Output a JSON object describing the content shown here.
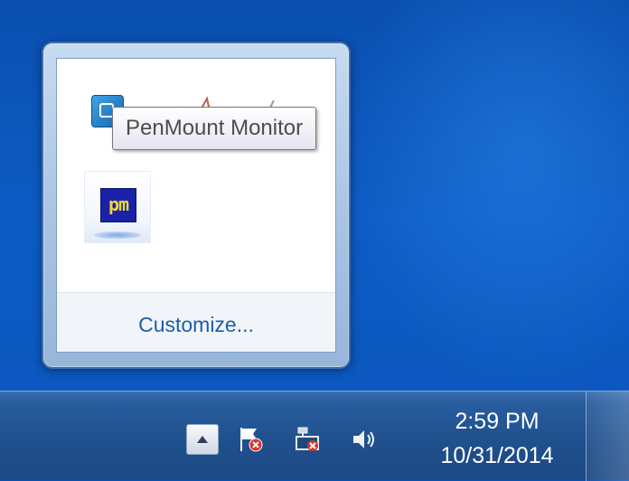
{
  "tooltip": {
    "text": "PenMount Monitor"
  },
  "flyout": {
    "icons": [
      {
        "name": "PenMount Monitor",
        "icon": "penmount-monitor-icon"
      },
      {
        "name": "pm",
        "icon": "pm-icon",
        "label": "pm"
      }
    ],
    "customize_label": "Customize..."
  },
  "taskbar": {
    "tray_icons": [
      "show-hidden-icons-icon",
      "action-center-flag-icon",
      "network-icon",
      "volume-icon"
    ],
    "time": "2:59 PM",
    "date": "10/31/2014"
  },
  "colors": {
    "desktop": "#0d5cc4",
    "taskbar": "#1f4f8c",
    "link": "#1c5ea8",
    "tooltip_text": "#4c4c4c"
  }
}
